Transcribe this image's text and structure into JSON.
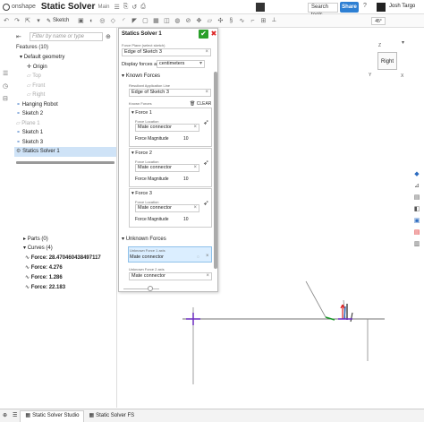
{
  "topbar": {
    "logo_text": "onshape",
    "doc_title": "Static Solver",
    "branch": "Main",
    "search_placeholder": "Search tools...",
    "share_label": "Share",
    "help": "?",
    "user_name": "Josh Targo"
  },
  "toolbar": {
    "sketch_label": "Sketch",
    "zoom": "45°"
  },
  "leftpanel": {
    "filter_placeholder": "Filter by name or type",
    "features_header": "Features (10)",
    "tree": [
      {
        "label": "Default geometry",
        "state": "normal"
      },
      {
        "label": "Origin",
        "state": "normal"
      },
      {
        "label": "Top",
        "state": "dim"
      },
      {
        "label": "Front",
        "state": "dim"
      },
      {
        "label": "Right",
        "state": "dim"
      },
      {
        "label": "Hanging Robot",
        "state": "normal"
      },
      {
        "label": "Sketch 2",
        "state": "normal"
      },
      {
        "label": "Plane 1",
        "state": "dim"
      },
      {
        "label": "Sketch 1",
        "state": "normal"
      },
      {
        "label": "Sketch 3",
        "state": "normal"
      },
      {
        "label": "Statics Solver 1",
        "state": "selected"
      }
    ],
    "parts_header": "Parts (0)",
    "curves_header": "Curves (4)",
    "curves": [
      "Force: 28.470460438497117",
      "Force: 4.276",
      "Force: 1.286",
      "Force: 22.183"
    ]
  },
  "dialog": {
    "title": "Statics Solver 1",
    "force_plane_label": "Force Plane (select sketch)",
    "force_plane_value": "Edge of Sketch 3",
    "display_forces_label": "Display forces as",
    "display_forces_value": "centimeters",
    "known_forces_header": "Known Forces",
    "resultant_label": "Resultant Application Line",
    "resultant_value": "Edge of Sketch 3",
    "known_forces_label": "Known Forces",
    "clear_label": "CLEAR",
    "forces": [
      {
        "name": "Force 1",
        "location_label": "Force Location",
        "location_value": "Mate connector",
        "magnitude_label": "Force Magnitude",
        "magnitude_value": "10"
      },
      {
        "name": "Force 2",
        "location_label": "Force Location",
        "location_value": "Mate connector",
        "magnitude_label": "Force Magnitude",
        "magnitude_value": "10"
      },
      {
        "name": "Force 3",
        "location_label": "Force Location",
        "location_value": "Mate connector",
        "magnitude_label": "Force Magnitude",
        "magnitude_value": "10"
      }
    ],
    "unknown_forces_header": "Unknown Forces",
    "unknown": [
      {
        "label": "Unknown Force 1 axis",
        "value": "Mate connector"
      },
      {
        "label": "Unknown Force 2 axis",
        "value": "Mate connector"
      }
    ]
  },
  "viewcube": {
    "face": "Right",
    "z": "Z",
    "y": "Y",
    "x": "X"
  },
  "tabs": [
    {
      "label": "Static Solver Studio",
      "active": true
    },
    {
      "label": "Static Solver FS",
      "active": false
    }
  ]
}
